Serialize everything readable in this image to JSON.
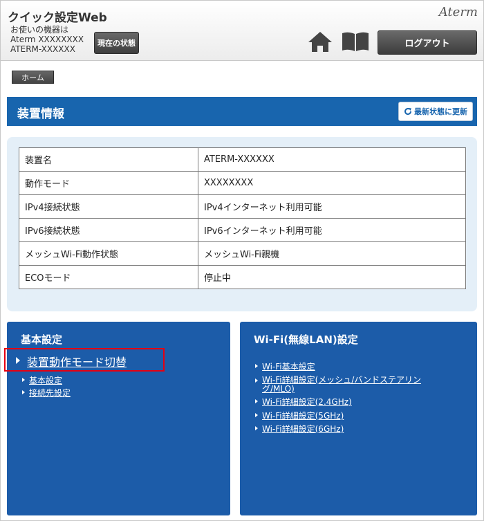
{
  "header": {
    "app_title": "クイック設定Web",
    "brand": "Aterm",
    "device_label": "お使いの機器は",
    "device_model": "Aterm XXXXXXXX",
    "device_name": "ATERM-XXXXXX",
    "status_button": "現在の状態",
    "logout_button": "ログアウト",
    "icons": [
      "home-icon",
      "book-icon"
    ]
  },
  "breadcrumb": {
    "home": "ホーム"
  },
  "device_info": {
    "title": "装置情報",
    "refresh_button": "最新状態に更新",
    "rows": [
      {
        "label": "装置名",
        "value": "ATERM-XXXXXX"
      },
      {
        "label": "動作モード",
        "value": "XXXXXXXX"
      },
      {
        "label": "IPv4接続状態",
        "value": "IPv4インターネット利用可能"
      },
      {
        "label": "IPv6接続状態",
        "value": "IPv6インターネット利用可能"
      },
      {
        "label": "メッシュWi-Fi動作状態",
        "value": "メッシュWi-Fi親機"
      },
      {
        "label": "ECOモード",
        "value": "停止中"
      }
    ]
  },
  "basic_settings": {
    "title": "基本設定",
    "links": [
      "装置動作モード切替",
      "基本設定",
      "接続先設定"
    ]
  },
  "wifi_settings": {
    "title": "Wi-Fi(無線LAN)設定",
    "links": [
      "Wi-Fi基本設定",
      "Wi-Fi詳細設定(メッシュ/バンドステアリング/MLO)",
      "Wi-Fi詳細設定(2.4GHz)",
      "Wi-Fi詳細設定(5GHz)",
      "Wi-Fi詳細設定(6GHz)"
    ]
  },
  "colors": {
    "primary_blue": "#1865ae",
    "panel_blue": "#1c5ca9",
    "highlight_red": "#e60012",
    "info_bg": "#e4eff8"
  }
}
